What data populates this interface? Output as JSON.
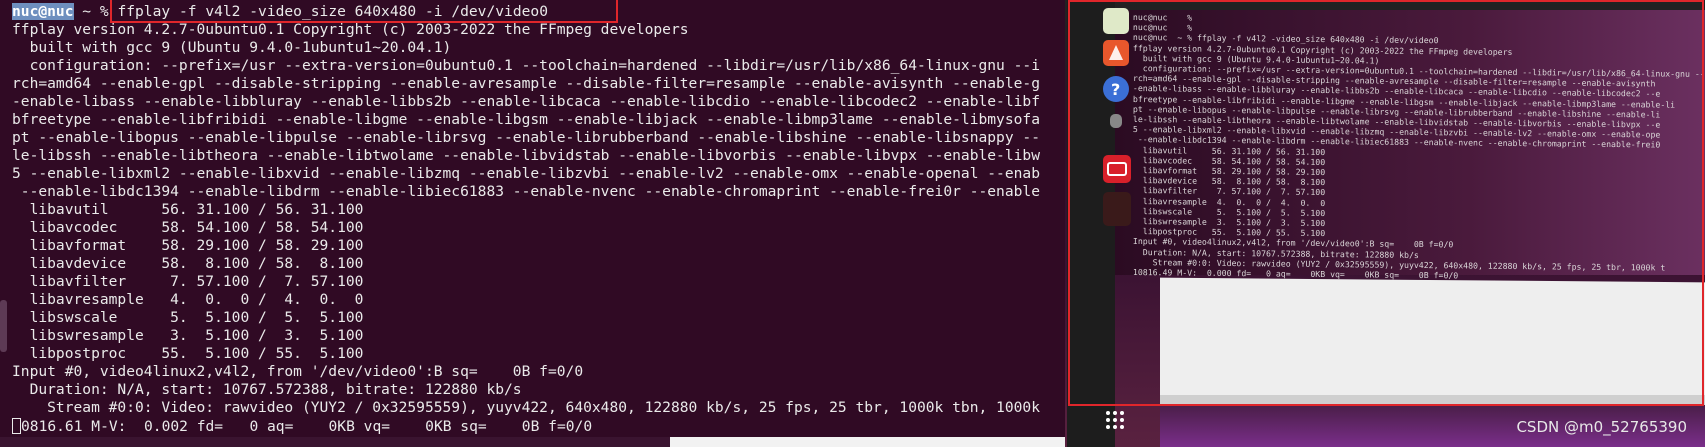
{
  "terminal": {
    "prompt_user": "nuc@nuc",
    "prompt_rest": " ~ % ",
    "command": "ffplay -f v4l2 -video_size 640x480 -i /dev/video0",
    "lines": [
      "ffplay version 4.2.7-0ubuntu0.1 Copyright (c) 2003-2022 the FFmpeg developers",
      "  built with gcc 9 (Ubuntu 9.4.0-1ubuntu1~20.04.1)",
      "  configuration: --prefix=/usr --extra-version=0ubuntu0.1 --toolchain=hardened --libdir=/usr/lib/x86_64-linux-gnu --i",
      "rch=amd64 --enable-gpl --disable-stripping --enable-avresample --disable-filter=resample --enable-avisynth --enable-g",
      "-enable-libass --enable-libbluray --enable-libbs2b --enable-libcaca --enable-libcdio --enable-libcodec2 --enable-libf",
      "bfreetype --enable-libfribidi --enable-libgme --enable-libgsm --enable-libjack --enable-libmp3lame --enable-libmysofa",
      "pt --enable-libopus --enable-libpulse --enable-librsvg --enable-librubberband --enable-libshine --enable-libsnappy --",
      "le-libssh --enable-libtheora --enable-libtwolame --enable-libvidstab --enable-libvorbis --enable-libvpx --enable-libw",
      "5 --enable-libxml2 --enable-libxvid --enable-libzmq --enable-libzvbi --enable-lv2 --enable-omx --enable-openal --enab",
      " --enable-libdc1394 --enable-libdrm --enable-libiec61883 --enable-nvenc --enable-chromaprint --enable-frei0r --enable",
      "  libavutil      56. 31.100 / 56. 31.100",
      "  libavcodec     58. 54.100 / 58. 54.100",
      "  libavformat    58. 29.100 / 58. 29.100",
      "  libavdevice    58.  8.100 / 58.  8.100",
      "  libavfilter     7. 57.100 /  7. 57.100",
      "  libavresample   4.  0.  0 /  4.  0.  0",
      "  libswscale      5.  5.100 /  5.  5.100",
      "  libswresample   3.  5.100 /  3.  5.100",
      "  libpostproc    55.  5.100 / 55.  5.100",
      "Input #0, video4linux2,v4l2, from '/dev/video0':B sq=    0B f=0/0",
      "  Duration: N/A, start: 10767.572388, bitrate: 122880 kb/s",
      "    Stream #0:0: Video: rawvideo (YUY2 / 0x32595559), yuyv422, 640x480, 122880 kb/s, 25 fps, 25 tbr, 1000k tbn, 1000k"
    ],
    "status_line": "0816.61 M-V:  0.002 fd=   0 aq=    0KB vq=    0KB sq=    0B f=0/0"
  },
  "photo": {
    "lines": [
      "nuc@nuc    %",
      "nuc@nuc    %",
      "nuc@nuc  ~ % ffplay -f v4l2 -video_size 640x480 -i /dev/video0",
      "ffplay version 4.2.7-0ubuntu0.1 Copyright (c) 2003-2022 the FFmpeg developers",
      "  built with gcc 9 (Ubuntu 9.4.0-1ubuntu1~20.04.1)",
      "  configuration: --prefix=/usr --extra-version=0ubuntu0.1 --toolchain=hardened --libdir=/usr/lib/x86_64-linux-gnu --i",
      "rch=amd64 --enable-gpl --disable-stripping --enable-avresample --disable-filter=resample --enable-avisynth",
      "-enable-libass --enable-libbluray --enable-libbs2b --enable-libcaca --enable-libcdio --enable-libcodec2 --e",
      "bfreetype --enable-libfribidi --enable-libgme --enable-libgsm --enable-libjack --enable-libmp3lame --enable-li",
      "pt --enable-libopus --enable-libpulse --enable-librsvg --enable-librubberband --enable-libshine --enable-li",
      "le-libssh --enable-libtheora --enable-libtwolame --enable-libvidstab --enable-libvorbis --enable-libvpx --e",
      "5 --enable-libxml2 --enable-libxvid --enable-libzmq --enable-libzvbi --enable-lv2 --enable-omx --enable-ope",
      " --enable-libdc1394 --enable-libdrm --enable-libiec61883 --enable-nvenc --enable-chromaprint --enable-frei0",
      "  libavutil     56. 31.100 / 56. 31.100",
      "  libavcodec    58. 54.100 / 58. 54.100",
      "  libavformat   58. 29.100 / 58. 29.100",
      "  libavdevice   58.  8.100 / 58.  8.100",
      "  libavfilter    7. 57.100 /  7. 57.100",
      "  libavresample  4.  0.  0 /  4.  0.  0",
      "  libswscale     5.  5.100 /  5.  5.100",
      "  libswresample  3.  5.100 /  3.  5.100",
      "  libpostproc   55.  5.100 / 55.  5.100",
      "Input #0, video4linux2,v4l2, from '/dev/video0':B sq=    0B f=0/0",
      "  Duration: N/A, start: 10767.572388, bitrate: 122880 kb/s",
      "    Stream #0:0: Video: rawvideo (YUY2 / 0x32595559), yuyv422, 640x480, 122880 kb/s, 25 fps, 25 tbr, 1000k t",
      "10816.49 M-V:  0.000 fd=   0 aq=    0KB vq=    0KB sq=    0B f=0/0"
    ],
    "dock_colors": {
      "files": "#dfe9c8",
      "software": "#e8572c",
      "help": "#3b6fd6",
      "app_red": "#d8202a"
    }
  },
  "watermark": "CSDN @m0_52765390"
}
